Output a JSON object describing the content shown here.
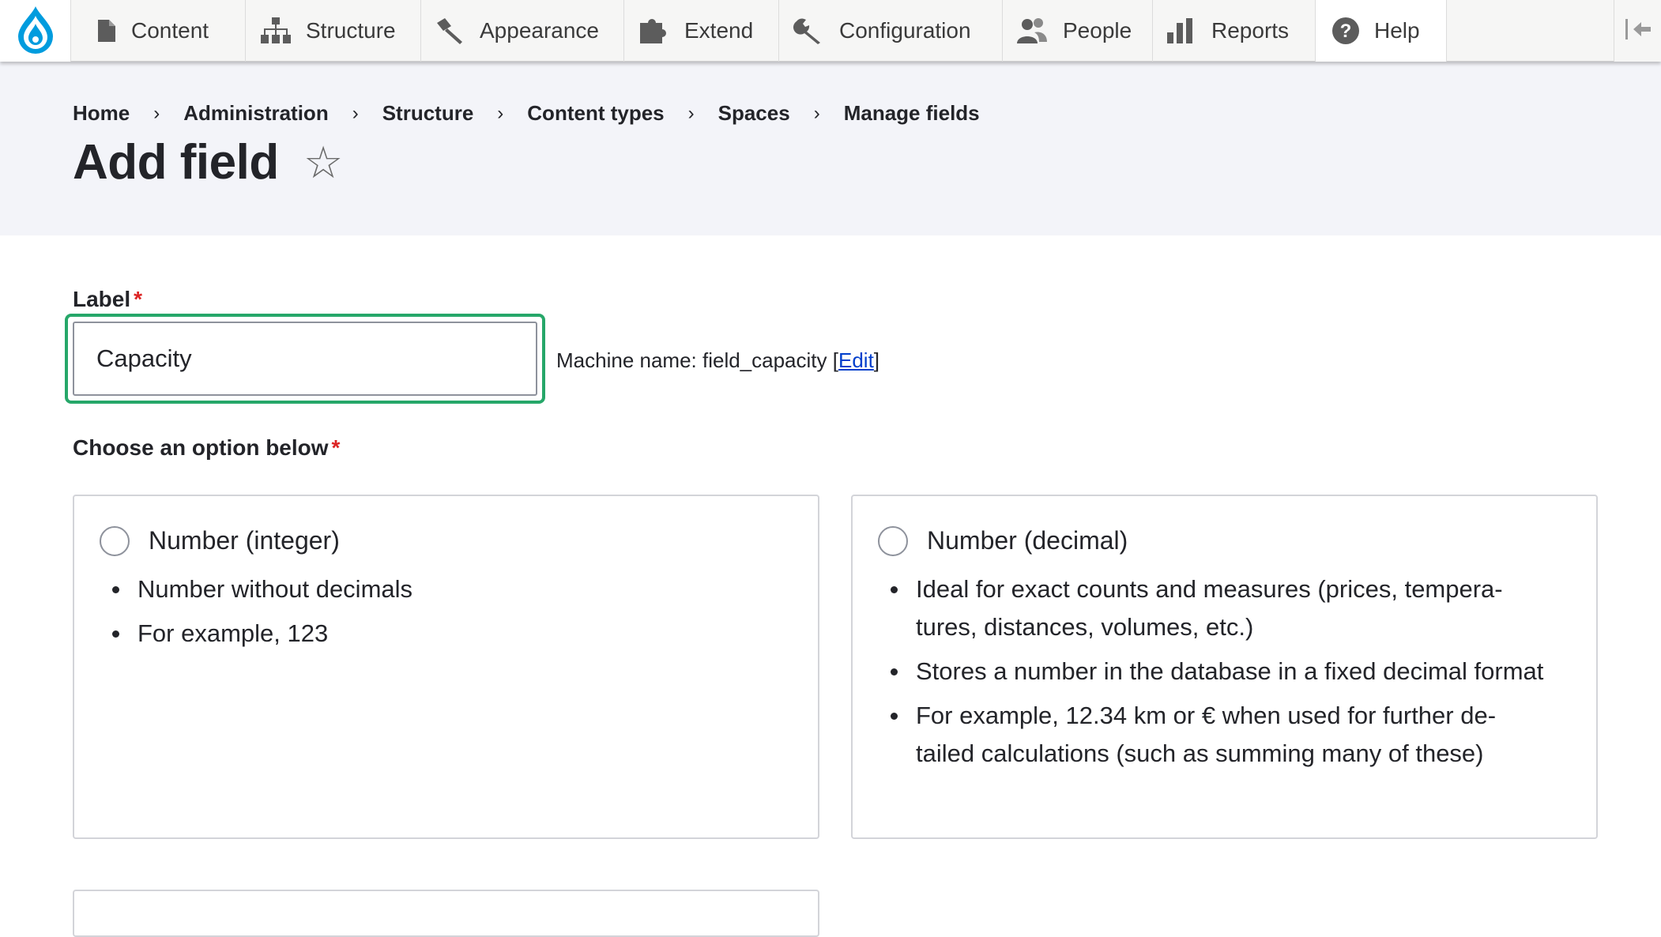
{
  "toolbar": {
    "logo": "drupal-drop-icon",
    "items": [
      {
        "label": "Content",
        "icon": "document-icon"
      },
      {
        "label": "Structure",
        "icon": "sitemap-icon"
      },
      {
        "label": "Appearance",
        "icon": "paintbrush-icon"
      },
      {
        "label": "Extend",
        "icon": "puzzle-icon"
      },
      {
        "label": "Configuration",
        "icon": "wrench-icon"
      },
      {
        "label": "People",
        "icon": "people-icon"
      },
      {
        "label": "Reports",
        "icon": "bar-chart-icon"
      },
      {
        "label": "Help",
        "icon": "help-icon"
      }
    ],
    "collapse_icon": "collapse-toolbar-icon"
  },
  "breadcrumb": {
    "items": [
      "Home",
      "Administration",
      "Structure",
      "Content types",
      "Spaces",
      "Manage fields"
    ],
    "separator": "›"
  },
  "page": {
    "title": "Add field",
    "favorite_icon": "☆"
  },
  "form": {
    "label_field": {
      "label": "Label",
      "required_marker": "*",
      "value": "Capacity"
    },
    "machine_name": {
      "prefix": "Machine name: field_capacity ",
      "open_bracket": "[",
      "edit_link": "Edit",
      "close_bracket": "]"
    },
    "choose": {
      "label": "Choose an option below",
      "required_marker": "*"
    },
    "options": [
      {
        "title": "Number (integer)",
        "bullets": [
          "Number without decimals",
          "For example, 123"
        ]
      },
      {
        "title": "Number (decimal)",
        "bullets": [
          "Ideal for exact counts and measures (prices, tempera-tures, distances, volumes, etc.)",
          "Stores a number in the database in a fixed decimal format",
          "For example, 12.34 km or € when used for further de-tailed calculations (such as summing many of these)"
        ]
      }
    ]
  },
  "colors": {
    "focus_ring": "#26a769",
    "required": "#dc2323",
    "link": "#003ecc",
    "drupal_blue": "#009cde",
    "header_band": "#f3f4f9"
  }
}
